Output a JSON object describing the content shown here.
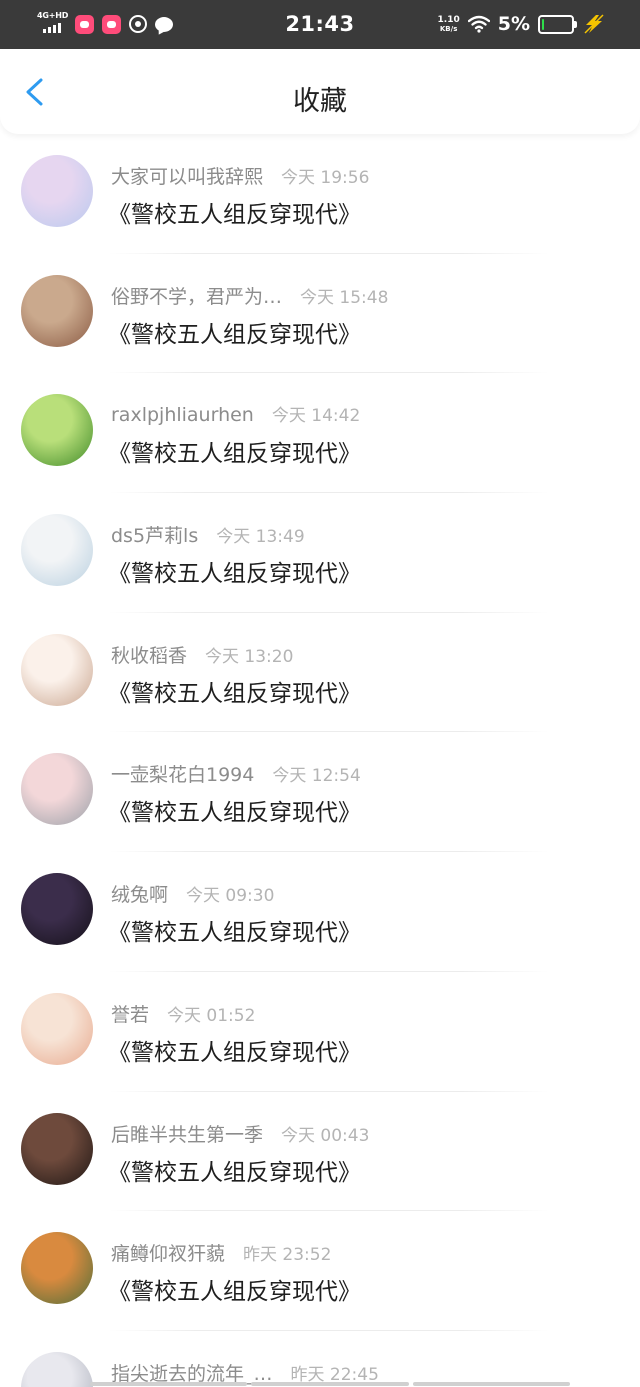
{
  "status_bar": {
    "time": "21:43",
    "network_type": "4G+HD",
    "speed_value": "1.10",
    "speed_unit": "KB/s",
    "battery_percent": "5%",
    "battery_level": 0.05,
    "battery_fill_color": "#2ee04a",
    "charging_icon": "bolt-icon"
  },
  "header": {
    "title": "收藏",
    "back_icon": "chevron-left-icon",
    "accent_color": "#2e9bf0"
  },
  "favorites": [
    {
      "name": "大家可以叫我辞熙",
      "time": "今天 19:56",
      "title": "《警校五人组反穿现代》",
      "avatar_colors": [
        "#e6d6f0",
        "#b9c9ee"
      ]
    },
    {
      "name": "俗野不学，君严为…",
      "time": "今天 15:48",
      "title": "《警校五人组反穿现代》",
      "avatar_colors": [
        "#caa98d",
        "#8a5a43"
      ]
    },
    {
      "name": "raxlpjhliaurhen",
      "time": "今天 14:42",
      "title": "《警校五人组反穿现代》",
      "avatar_colors": [
        "#b9df7a",
        "#3f8a28"
      ]
    },
    {
      "name": "ds5芦莉ls",
      "time": "今天 13:49",
      "title": "《警校五人组反穿现代》",
      "avatar_colors": [
        "#f2f4f6",
        "#b9d0e0"
      ]
    },
    {
      "name": "秋收稻香",
      "time": "今天 13:20",
      "title": "《警校五人组反穿现代》",
      "avatar_colors": [
        "#fbf1ea",
        "#c9a58f"
      ]
    },
    {
      "name": "一壶梨花白1994",
      "time": "今天 12:54",
      "title": "《警校五人组反穿现代》",
      "avatar_colors": [
        "#f3d7d9",
        "#9aa0a8"
      ]
    },
    {
      "name": "绒兔啊",
      "time": "今天 09:30",
      "title": "《警校五人组反穿现代》",
      "avatar_colors": [
        "#3b2d4b",
        "#141018"
      ]
    },
    {
      "name": "誉若",
      "time": "今天 01:52",
      "title": "《警校五人组反穿现代》",
      "avatar_colors": [
        "#f7e3d5",
        "#e7a98e"
      ]
    },
    {
      "name": "后睢半共生第一季",
      "time": "今天 00:43",
      "title": "《警校五人组反穿现代》",
      "avatar_colors": [
        "#6e4a3c",
        "#1e1614"
      ]
    },
    {
      "name": "痛鳟仰衩犴藐",
      "time": "昨天 23:52",
      "title": "《警校五人组反穿现代》",
      "avatar_colors": [
        "#d98a3f",
        "#4e6e3a"
      ]
    },
    {
      "name": "指尖逝去的流年_…",
      "time": "昨天 22:45",
      "title": "",
      "avatar_colors": [
        "#e8e8ee",
        "#a8acb8"
      ]
    }
  ]
}
